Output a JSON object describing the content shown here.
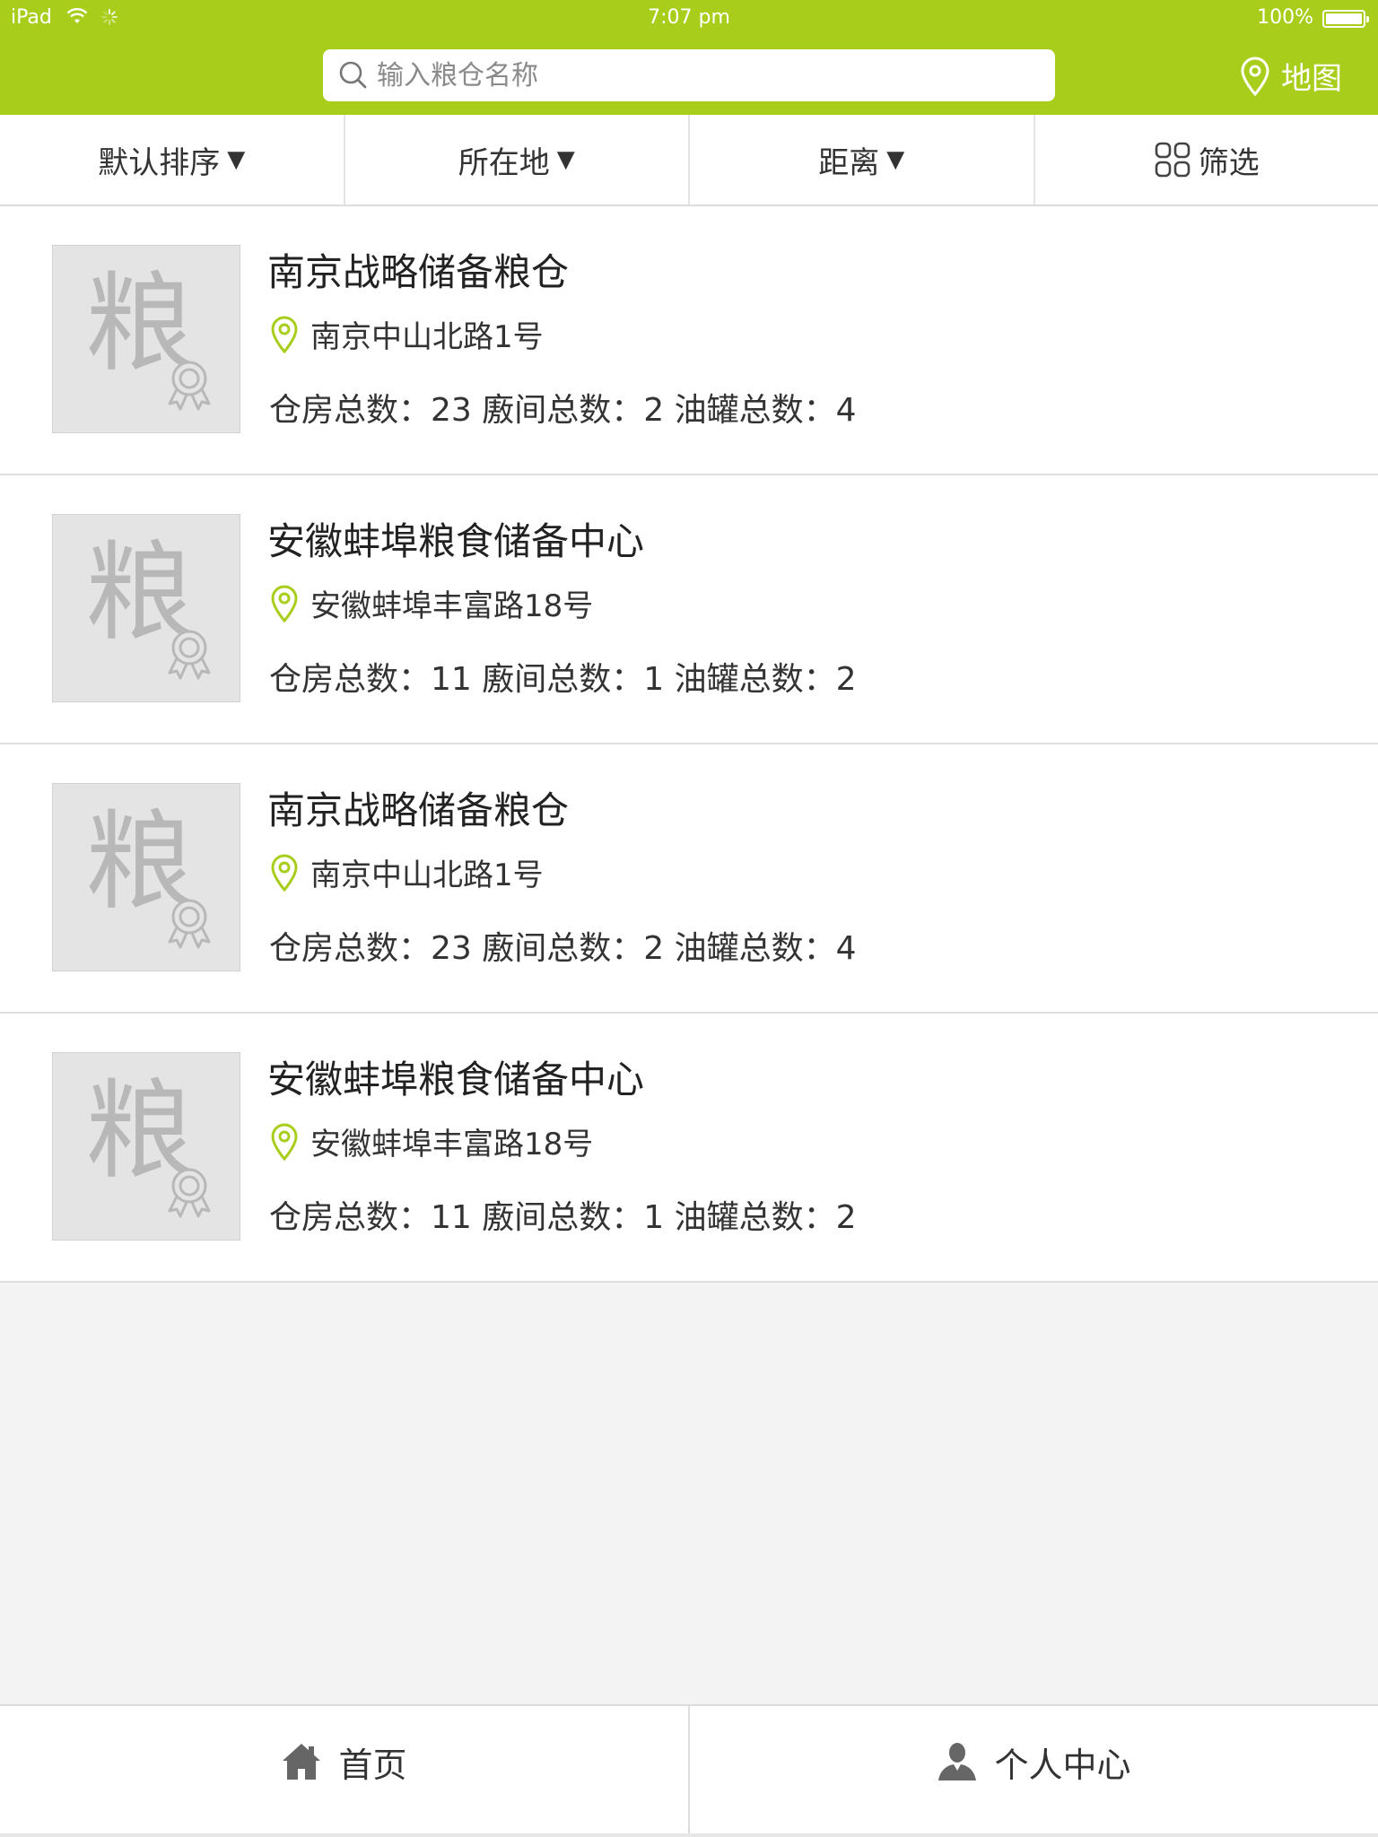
{
  "status_bar": {
    "device": "iPad",
    "time": "7:07 pm",
    "battery": "100%"
  },
  "header": {
    "search_placeholder": "输入粮仓名称",
    "map_label": "地图",
    "accent_color": "#a8ce1b"
  },
  "filters": [
    {
      "label": "默认排序",
      "arrow": "▼"
    },
    {
      "label": "所在地",
      "arrow": "▼"
    },
    {
      "label": "距离",
      "arrow": "▼"
    },
    {
      "label": "筛选",
      "icon": "grid-icon"
    }
  ],
  "thumb_glyph": "粮",
  "granaries": [
    {
      "name": "南京战略储备粮仓",
      "address": "南京中山北路1号",
      "stats": "仓房总数：23 廒间总数：2 油罐总数：4"
    },
    {
      "name": "安徽蚌埠粮食储备中心",
      "address": "安徽蚌埠丰富路18号",
      "stats": "仓房总数：11 廒间总数：1 油罐总数：2"
    },
    {
      "name": "南京战略储备粮仓",
      "address": "南京中山北路1号",
      "stats": "仓房总数：23 廒间总数：2 油罐总数：4"
    },
    {
      "name": "安徽蚌埠粮食储备中心",
      "address": "安徽蚌埠丰富路18号",
      "stats": "仓房总数：11 廒间总数：1 油罐总数：2"
    }
  ],
  "tabs": [
    {
      "label": "首页",
      "icon": "home-icon"
    },
    {
      "label": "个人中心",
      "icon": "user-icon"
    }
  ]
}
